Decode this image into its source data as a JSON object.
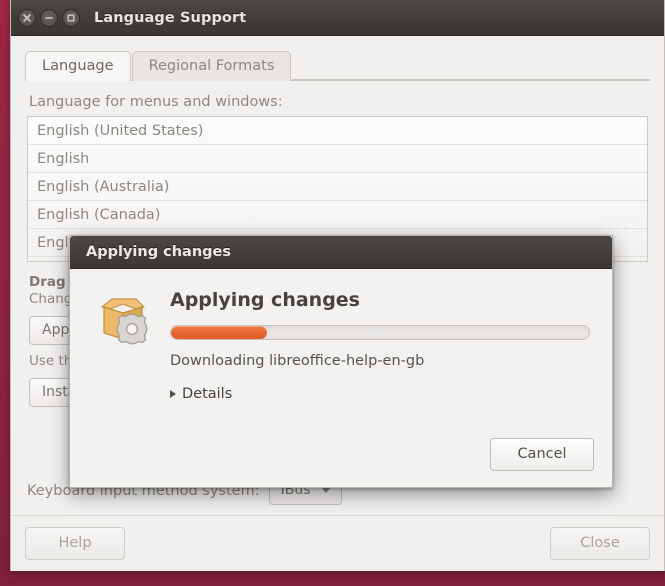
{
  "window": {
    "title": "Language Support",
    "controls": [
      {
        "name": "close",
        "glyph": "×"
      },
      {
        "name": "minimize",
        "glyph": "−"
      },
      {
        "name": "maximize",
        "glyph": "□"
      }
    ]
  },
  "tabs": [
    {
      "label": "Language",
      "active": true
    },
    {
      "label": "Regional Formats",
      "active": false
    }
  ],
  "panel": {
    "list_label": "Language for menus and windows:",
    "languages": [
      "English (United States)",
      "English",
      "English (Australia)",
      "English (Canada)",
      "English (United Kingdom)"
    ],
    "drag_title": "Drag languages to arrange them in order of preference.",
    "drag_sub": "Changes take effect next time you log in.",
    "apply_button": "Apply System-Wide",
    "apply_hint": "Use the same language choices for startup and the login screen.",
    "install_button": "Install / Remove Languages...",
    "input_method_label": "Keyboard input method system:",
    "input_method_value": "IBus"
  },
  "footer": {
    "help_label": "Help",
    "close_label": "Close"
  },
  "dialog": {
    "title": "Applying changes",
    "heading": "Applying changes",
    "status": "Downloading libreoffice-help-en-gb",
    "details_label": "Details",
    "cancel_label": "Cancel",
    "progress_percent": 23
  },
  "colors": {
    "accent_orange": "#e4652f",
    "window_border_red": "#8d2340",
    "titlebar_dark": "#403c39"
  }
}
